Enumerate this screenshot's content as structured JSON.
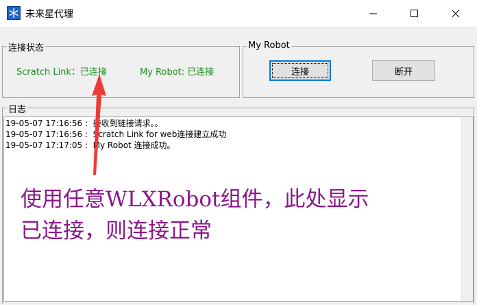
{
  "window": {
    "title": "未来星代理",
    "icons": {
      "app": "snowflake-icon",
      "minimize": "minimize-icon",
      "maximize": "maximize-icon",
      "close": "close-icon"
    }
  },
  "connection_status": {
    "group_label": "连接状态",
    "scratch_link": "Scratch Link：已连接",
    "my_robot": "My Robot: 已连接"
  },
  "my_robot_group": {
    "group_label": "My Robot",
    "connect_button": "连接",
    "disconnect_button": "断开"
  },
  "log": {
    "group_label": "日志",
    "lines": [
      "19-05-07 17:16:56 :  接收到链接请求。。",
      "19-05-07 17:16:56 :  Scratch Link for web连接建立成功",
      "19-05-07 17:17:05 :  My Robot 连接成功。"
    ]
  },
  "annotation": {
    "line1": "使用任意WLXRobot组件，此处显示",
    "line2": "已连接，则连接正常",
    "color": "#8b168b",
    "arrow_color": "#f03a3a"
  },
  "colors": {
    "status_green": "#1c8c1c",
    "focus_blue": "#0078d7"
  }
}
